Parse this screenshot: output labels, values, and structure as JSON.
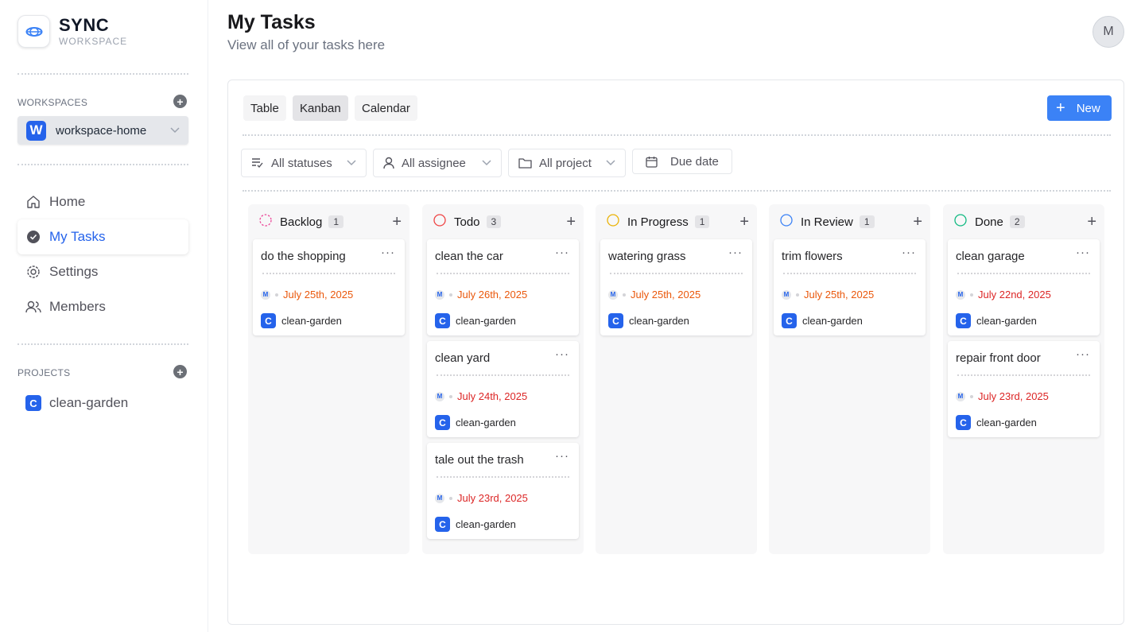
{
  "brand": {
    "title": "SYNC",
    "subtitle": "WORKSPACE"
  },
  "sidebar": {
    "workspaces_label": "WORKSPACES",
    "workspace": {
      "initial": "W",
      "name": "workspace-home"
    },
    "nav": [
      {
        "label": "Home",
        "icon": "home-icon"
      },
      {
        "label": "My Tasks",
        "icon": "check-circle-icon"
      },
      {
        "label": "Settings",
        "icon": "gear-icon"
      },
      {
        "label": "Members",
        "icon": "users-icon"
      }
    ],
    "projects_label": "PROJECTS",
    "projects": [
      {
        "initial": "C",
        "name": "clean-garden"
      }
    ]
  },
  "header": {
    "title": "My Tasks",
    "subtitle": "View all of your tasks here",
    "avatar_initial": "M"
  },
  "views": {
    "table": "Table",
    "kanban": "Kanban",
    "calendar": "Calendar",
    "active": "Kanban"
  },
  "new_button": "New",
  "filters": {
    "status": "All statuses",
    "assignee": "All assignee",
    "project": "All project",
    "due": "Due date"
  },
  "colors": {
    "accent": "#3b82f6",
    "overdue": "#dc2626",
    "due_soon": "#ea580c"
  },
  "columns": [
    {
      "name": "Backlog",
      "count": "1",
      "color": "#ec4899",
      "cards": [
        {
          "title": "do the shopping",
          "date": "July 25th, 2025",
          "date_color": "#ea580c",
          "assignee": "M",
          "project_initial": "C",
          "project": "clean-garden"
        }
      ]
    },
    {
      "name": "Todo",
      "count": "3",
      "color": "#ef4444",
      "cards": [
        {
          "title": "clean the car",
          "date": "July 26th, 2025",
          "date_color": "#ea580c",
          "assignee": "M",
          "project_initial": "C",
          "project": "clean-garden"
        },
        {
          "title": "clean yard",
          "date": "July 24th, 2025",
          "date_color": "#dc2626",
          "assignee": "M",
          "project_initial": "C",
          "project": "clean-garden"
        },
        {
          "title": "tale out the trash",
          "date": "July 23rd, 2025",
          "date_color": "#dc2626",
          "assignee": "M",
          "project_initial": "C",
          "project": "clean-garden"
        }
      ]
    },
    {
      "name": "In Progress",
      "count": "1",
      "color": "#eab308",
      "cards": [
        {
          "title": "watering grass",
          "date": "July 25th, 2025",
          "date_color": "#ea580c",
          "assignee": "M",
          "project_initial": "C",
          "project": "clean-garden"
        }
      ]
    },
    {
      "name": "In Review",
      "count": "1",
      "color": "#3b82f6",
      "cards": [
        {
          "title": "trim flowers",
          "date": "July 25th, 2025",
          "date_color": "#ea580c",
          "assignee": "M",
          "project_initial": "C",
          "project": "clean-garden"
        }
      ]
    },
    {
      "name": "Done",
      "count": "2",
      "color": "#10b981",
      "cards": [
        {
          "title": "clean garage",
          "date": "July 22nd, 2025",
          "date_color": "#dc2626",
          "assignee": "M",
          "project_initial": "C",
          "project": "clean-garden"
        },
        {
          "title": "repair front door",
          "date": "July 23rd, 2025",
          "date_color": "#dc2626",
          "assignee": "M",
          "project_initial": "C",
          "project": "clean-garden"
        }
      ]
    }
  ]
}
